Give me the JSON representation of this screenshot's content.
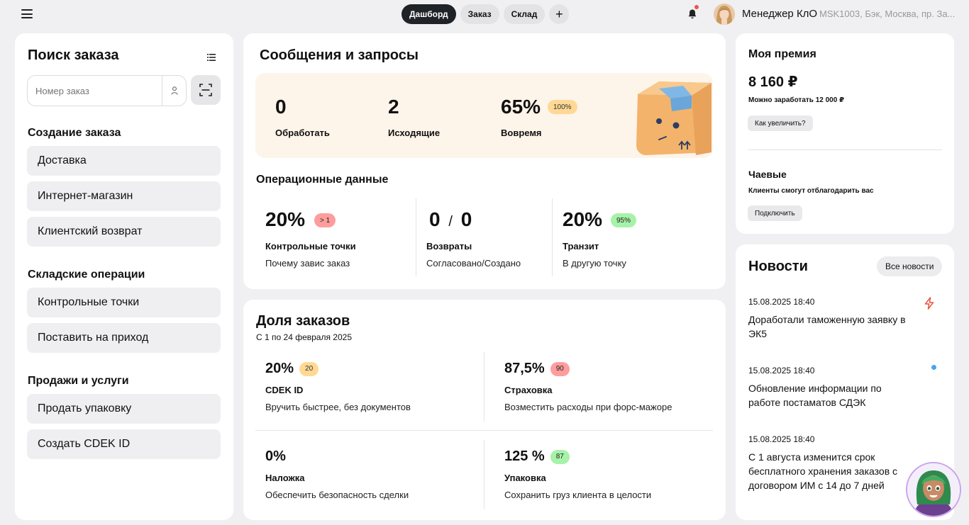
{
  "topbar": {
    "tabs": [
      {
        "label": "Дашборд",
        "active": true
      },
      {
        "label": "Заказ",
        "active": false
      },
      {
        "label": "Склад",
        "active": false
      }
    ],
    "add_tab_label": "+",
    "user_name": "Менеджер КлО",
    "user_location": "MSK1003, Бэк, Москва, пр. За..."
  },
  "left": {
    "title": "Поиск заказа",
    "search_placeholder": "Номер заказ",
    "sections": [
      {
        "title": "Создание заказа",
        "items": [
          "Доставка",
          "Интернет-магазин",
          "Клиентский возврат"
        ]
      },
      {
        "title": "Складские операции",
        "items": [
          "Контрольные точки",
          "Поставить на приход"
        ]
      },
      {
        "title": "Продажи и услуги",
        "items": [
          "Продать упаковку",
          "Создать CDEK ID"
        ]
      }
    ]
  },
  "messages": {
    "title": "Сообщения и запросы",
    "stats": [
      {
        "value": "0",
        "label": "Обработать"
      },
      {
        "value": "2",
        "label": "Исходящие"
      },
      {
        "value": "65%",
        "label": "Вовремя",
        "badge": "100%"
      }
    ]
  },
  "ops": {
    "title": "Операционные данные",
    "items": [
      {
        "value": "20%",
        "badge": "> 1",
        "label": "Контрольные точки",
        "sub": "Почему завис заказ"
      },
      {
        "value_a": "0",
        "sep": "/",
        "value_b": "0",
        "label": "Возвраты",
        "sub": "Согласовано/Создано"
      },
      {
        "value": "20%",
        "badge": "95%",
        "label": "Транзит",
        "sub": "В другую точку"
      }
    ]
  },
  "share": {
    "title": "Доля заказов",
    "period": "С 1 по 24 февраля 2025",
    "items": [
      {
        "value": "20%",
        "badge": "20",
        "label": "CDEK ID",
        "sub": "Вручить быстрее, без документов"
      },
      {
        "value": "87,5%",
        "badge": "90",
        "label": "Страховка",
        "sub": "Возместить расходы при форс-мажоре"
      },
      {
        "value": "0%",
        "label": "Наложка",
        "sub": "Обеспечить безопасность сделки"
      },
      {
        "value": "125 %",
        "badge": "87",
        "label": "Упаковка",
        "sub": "Сохранить груз клиента в целости"
      }
    ]
  },
  "bonus": {
    "title": "Моя премия",
    "amount": "8 160 ₽",
    "can_earn": "Можно заработать 12 000 ₽",
    "increase_btn": "Как увеличить?",
    "tips_title": "Чаевые",
    "tips_sub": "Клиенты смогут отблагодарить вас",
    "connect_btn": "Подключить"
  },
  "news": {
    "title": "Новости",
    "all_btn": "Все новости",
    "items": [
      {
        "date": "15.08.2025 18:40",
        "text": "Доработали таможенную заявку в ЭК5",
        "marker": "lightning-icon"
      },
      {
        "date": "15.08.2025 18:40",
        "text": "Обновление информации по работе постаматов СДЭК",
        "marker": "unread-dot"
      },
      {
        "date": "15.08.2025 18:40",
        "text": "С 1 августа изменится срок бесплатного хранения заказов с договором ИМ с 14 до 7 дней"
      }
    ]
  },
  "colors": {
    "accent_dark": "#1f2227",
    "banner_bg": "#fdf4ea",
    "badge_orange": "#ffd994",
    "badge_red": "#ff9d9d",
    "badge_green": "#a6f2a8",
    "notification_dot": "#ef5350",
    "unread_dot": "#42a5f5",
    "lightning": "#e8553f"
  }
}
